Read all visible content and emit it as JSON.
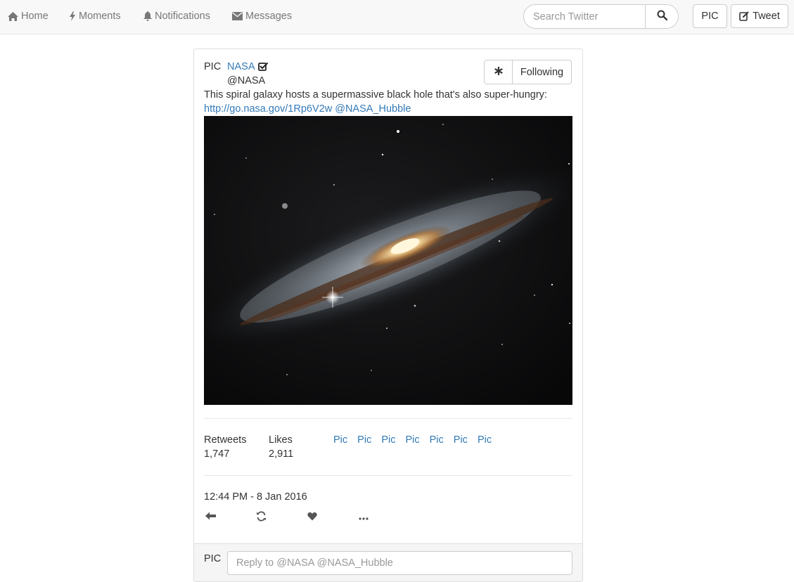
{
  "nav": {
    "home": "Home",
    "moments": "Moments",
    "notifications": "Notifications",
    "messages": "Messages",
    "search_placeholder": "Search Twitter",
    "pic": "PIC",
    "tweet": "Tweet"
  },
  "icons": {
    "home": "home-icon",
    "moments": "lightning-icon",
    "notifications": "bell-icon",
    "messages": "envelope-icon",
    "search": "search-icon",
    "compose": "compose-icon",
    "verified": "verified-check-icon",
    "settings": "asterisk-icon",
    "reply": "reply-arrow-icon",
    "retweet": "retweet-icon",
    "like": "heart-icon",
    "more": "more-dots-icon"
  },
  "tweet": {
    "avatar": "PIC",
    "name": "NASA",
    "handle": "@NASA",
    "follow_label": "Following",
    "text": "This spiral galaxy hosts a supermassive black hole that's also super-hungry:",
    "link": "http://go.nasa.gov/1Rp6V2w",
    "mention": "@NASA_Hubble",
    "retweets_label": "Retweets",
    "retweets": "1,747",
    "likes_label": "Likes",
    "likes": "2,911",
    "likers": [
      "Pic",
      "Pic",
      "Pic",
      "Pic",
      "Pic",
      "Pic",
      "Pic"
    ],
    "timestamp": "12:44 PM - 8 Jan 2016"
  },
  "reply": {
    "avatar": "PIC",
    "placeholder": "Reply to @NASA @NASA_Hubble"
  },
  "colors": {
    "link": "#337ab7",
    "navbar_bg": "#f8f8f8",
    "text": "#333333",
    "muted": "#777777"
  }
}
